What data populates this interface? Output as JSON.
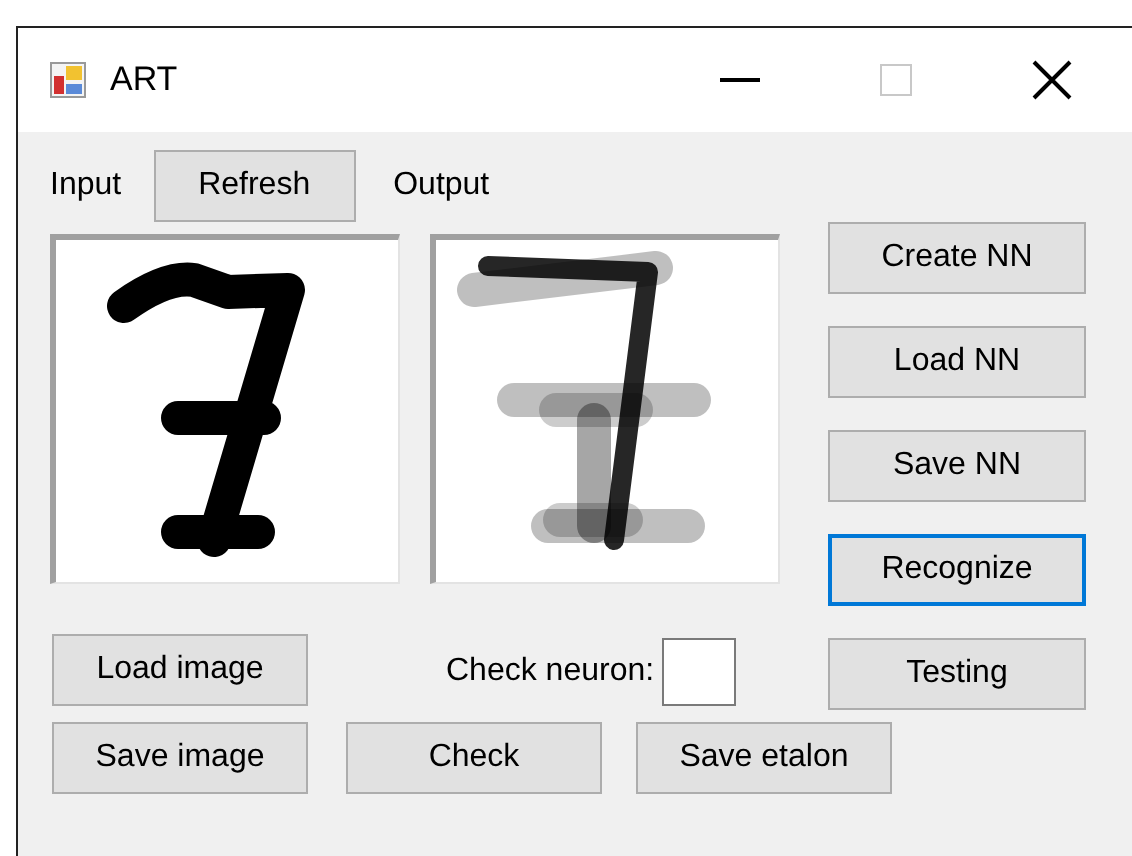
{
  "window": {
    "title": "ART",
    "maximize_enabled": false
  },
  "input_label": "Input",
  "refresh_button": "Refresh",
  "output_label": "Output",
  "side_buttons": [
    {
      "label": "Create NN",
      "focused": false
    },
    {
      "label": "Load NN",
      "focused": false
    },
    {
      "label": "Save NN",
      "focused": false
    },
    {
      "label": "Recognize",
      "focused": true
    },
    {
      "label": "Testing",
      "focused": false
    }
  ],
  "load_image_button": "Load image",
  "check_neuron": {
    "label": "Check neuron:"
  },
  "bottom_buttons": [
    "Save image",
    "Check",
    "Save etalon"
  ]
}
